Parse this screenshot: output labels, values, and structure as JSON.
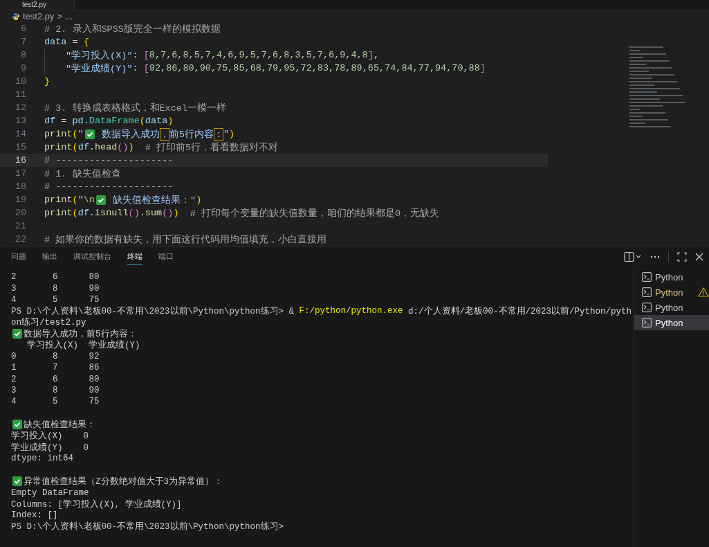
{
  "editor_tab": {
    "label": "test2.py"
  },
  "breadcrumb": {
    "file": "test2.py",
    "separator": ">",
    "rest": "..."
  },
  "code_lines": [
    {
      "number": "6",
      "current": false,
      "tokens": [
        {
          "kind": "comment",
          "text": "# 2. 录入和SPSS版完全一样的模拟数据"
        }
      ]
    },
    {
      "number": "7",
      "current": false,
      "tokens": [
        {
          "kind": "var",
          "text": "data"
        },
        {
          "kind": "plain",
          "text": " = "
        },
        {
          "kind": "brace",
          "text": "{"
        }
      ]
    },
    {
      "number": "8",
      "current": false,
      "indented": true,
      "tokens": [
        {
          "kind": "string",
          "text": "\"学习投入(X)\""
        },
        {
          "kind": "plain",
          "text": ": "
        },
        {
          "kind": "bracket",
          "text": "["
        },
        {
          "kind": "number",
          "text": "8,7,6,8,5,7,4,6,9,5,7,6,8,3,5,7,6,9,4,8"
        },
        {
          "kind": "bracket",
          "text": "]"
        },
        {
          "kind": "plain",
          "text": ","
        }
      ]
    },
    {
      "number": "9",
      "current": false,
      "indented": true,
      "tokens": [
        {
          "kind": "string",
          "text": "\"学业成绩(Y)\""
        },
        {
          "kind": "plain",
          "text": ": "
        },
        {
          "kind": "bracket",
          "text": "["
        },
        {
          "kind": "number",
          "text": "92,86,80,90,75,85,68,79,95,72,83,78,89,65,74,84,77,94,70,88"
        },
        {
          "kind": "bracket",
          "text": "]"
        }
      ]
    },
    {
      "number": "10",
      "current": false,
      "tokens": [
        {
          "kind": "brace",
          "text": "}"
        }
      ]
    },
    {
      "number": "11",
      "current": false
    },
    {
      "number": "12",
      "current": false,
      "tokens": [
        {
          "kind": "comment",
          "text": "# 3. 转换成表格格式，和Excel一模一样"
        }
      ]
    },
    {
      "number": "13",
      "current": false,
      "tokens": [
        {
          "kind": "var",
          "text": "df"
        },
        {
          "kind": "plain",
          "text": " = "
        },
        {
          "kind": "var",
          "text": "pd"
        },
        {
          "kind": "plain",
          "text": "."
        },
        {
          "kind": "class",
          "text": "DataFrame"
        },
        {
          "kind": "brace",
          "text": "("
        },
        {
          "kind": "var",
          "text": "data"
        },
        {
          "kind": "brace",
          "text": ")"
        }
      ]
    },
    {
      "number": "14",
      "current": false,
      "tokens": [
        {
          "kind": "func",
          "text": "print"
        },
        {
          "kind": "brace",
          "text": "("
        },
        {
          "kind": "string",
          "text": "\""
        },
        {
          "kind": "check"
        },
        {
          "kind": "string",
          "text": " 数据导入成功"
        },
        {
          "kind": "flagged",
          "text": "，"
        },
        {
          "kind": "string",
          "text": "前5行内容"
        },
        {
          "kind": "flagged",
          "text": "："
        },
        {
          "kind": "string",
          "text": "\""
        },
        {
          "kind": "brace",
          "text": ")"
        }
      ]
    },
    {
      "number": "15",
      "current": false,
      "tokens": [
        {
          "kind": "func",
          "text": "print"
        },
        {
          "kind": "brace",
          "text": "("
        },
        {
          "kind": "var",
          "text": "df"
        },
        {
          "kind": "plain",
          "text": "."
        },
        {
          "kind": "func",
          "text": "head"
        },
        {
          "kind": "bracket",
          "text": "()"
        },
        {
          "kind": "brace",
          "text": ")"
        },
        {
          "kind": "comment",
          "text": "  # 打印前5行，看看数据对不对"
        }
      ]
    },
    {
      "number": "16",
      "current": true,
      "tokens": [
        {
          "kind": "comment",
          "text": "# ---------------------"
        }
      ]
    },
    {
      "number": "17",
      "current": false,
      "tokens": [
        {
          "kind": "comment",
          "text": "# 1. 缺失值检查"
        }
      ]
    },
    {
      "number": "18",
      "current": false,
      "tokens": [
        {
          "kind": "comment",
          "text": "# ---------------------"
        }
      ]
    },
    {
      "number": "19",
      "current": false,
      "tokens": [
        {
          "kind": "func",
          "text": "print"
        },
        {
          "kind": "brace",
          "text": "("
        },
        {
          "kind": "string",
          "text": "\""
        },
        {
          "kind": "escape",
          "text": "\\n"
        },
        {
          "kind": "check"
        },
        {
          "kind": "string",
          "text": " 缺失值检查结果：\""
        },
        {
          "kind": "brace",
          "text": ")"
        }
      ]
    },
    {
      "number": "20",
      "current": false,
      "tokens": [
        {
          "kind": "func",
          "text": "print"
        },
        {
          "kind": "brace",
          "text": "("
        },
        {
          "kind": "var",
          "text": "df"
        },
        {
          "kind": "plain",
          "text": "."
        },
        {
          "kind": "func",
          "text": "isnull"
        },
        {
          "kind": "bracket",
          "text": "()"
        },
        {
          "kind": "plain",
          "text": "."
        },
        {
          "kind": "func",
          "text": "sum"
        },
        {
          "kind": "bracket",
          "text": "()"
        },
        {
          "kind": "brace",
          "text": ")"
        },
        {
          "kind": "comment",
          "text": "  # 打印每个变量的缺失值数量，咱们的结果都是0，无缺失"
        }
      ]
    },
    {
      "number": "21",
      "current": false
    },
    {
      "number": "22",
      "current": false,
      "tokens": [
        {
          "kind": "comment",
          "text": "# 如果你的数据有缺失，用下面这行代码用均值填充，小白直接用"
        }
      ]
    }
  ],
  "panel_tabs": [
    {
      "label": "问题",
      "selected": false
    },
    {
      "label": "输出",
      "selected": false
    },
    {
      "label": "调试控制台",
      "selected": false
    },
    {
      "label": "终端",
      "selected": true
    },
    {
      "label": "端口",
      "selected": false
    }
  ],
  "terminal_lines": [
    {
      "check": false,
      "segments": [
        {
          "kind": "plain",
          "text": "2       6      80"
        }
      ]
    },
    {
      "check": false,
      "segments": [
        {
          "kind": "plain",
          "text": "3       8      90"
        }
      ]
    },
    {
      "check": false,
      "segments": [
        {
          "kind": "plain",
          "text": "4       5      75"
        }
      ]
    },
    {
      "check": false,
      "segments": [
        {
          "kind": "plain",
          "text": "PS D:\\个人资料\\老板00-不常用\\2023以前\\Python\\python练习> & "
        },
        {
          "kind": "command",
          "text": "F:/python/python.exe"
        },
        {
          "kind": "path",
          "text": " d:/个人资料/老板00-不常用/2023以前/Python/pyth"
        }
      ]
    },
    {
      "check": false,
      "segments": [
        {
          "kind": "path",
          "text": "on练习/test2.py"
        }
      ]
    },
    {
      "check": true,
      "segments": [
        {
          "kind": "plain",
          "text": "数据导入成功，前5行内容："
        }
      ]
    },
    {
      "check": false,
      "segments": [
        {
          "kind": "plain",
          "text": "   学习投入(X)  学业成绩(Y)"
        }
      ]
    },
    {
      "check": false,
      "segments": [
        {
          "kind": "plain",
          "text": "0       8      92"
        }
      ]
    },
    {
      "check": false,
      "segments": [
        {
          "kind": "plain",
          "text": "1       7      86"
        }
      ]
    },
    {
      "check": false,
      "segments": [
        {
          "kind": "plain",
          "text": "2       6      80"
        }
      ]
    },
    {
      "check": false,
      "segments": [
        {
          "kind": "plain",
          "text": "3       8      90"
        }
      ]
    },
    {
      "check": false,
      "segments": [
        {
          "kind": "plain",
          "text": "4       5      75"
        }
      ]
    },
    {
      "check": false
    },
    {
      "check": true,
      "segments": [
        {
          "kind": "plain",
          "text": "缺失值检查结果："
        }
      ]
    },
    {
      "check": false,
      "segments": [
        {
          "kind": "plain",
          "text": "学习投入(X)    0"
        }
      ]
    },
    {
      "check": false,
      "segments": [
        {
          "kind": "plain",
          "text": "学业成绩(Y)    0"
        }
      ]
    },
    {
      "check": false,
      "segments": [
        {
          "kind": "plain",
          "text": "dtype: int64"
        }
      ]
    },
    {
      "check": false
    },
    {
      "check": true,
      "segments": [
        {
          "kind": "plain",
          "text": "异常值检查结果（Z分数绝对值大于3为异常值）："
        }
      ]
    },
    {
      "check": false,
      "segments": [
        {
          "kind": "plain",
          "text": "Empty DataFrame"
        }
      ]
    },
    {
      "check": false,
      "segments": [
        {
          "kind": "plain",
          "text": "Columns: [学习投入(X), 学业成绩(Y)]"
        }
      ]
    },
    {
      "check": false,
      "segments": [
        {
          "kind": "plain",
          "text": "Index: []"
        }
      ]
    },
    {
      "check": false,
      "segments": [
        {
          "kind": "plain",
          "text": "PS D:\\个人资料\\老板00-不常用\\2023以前\\Python\\python练习>"
        }
      ]
    }
  ],
  "terminals": [
    {
      "label": "Python",
      "warning": false,
      "selected": false
    },
    {
      "label": "Python",
      "warning": true,
      "selected": false
    },
    {
      "label": "Python",
      "warning": false,
      "selected": false
    },
    {
      "label": "Python",
      "warning": false,
      "selected": true
    }
  ]
}
